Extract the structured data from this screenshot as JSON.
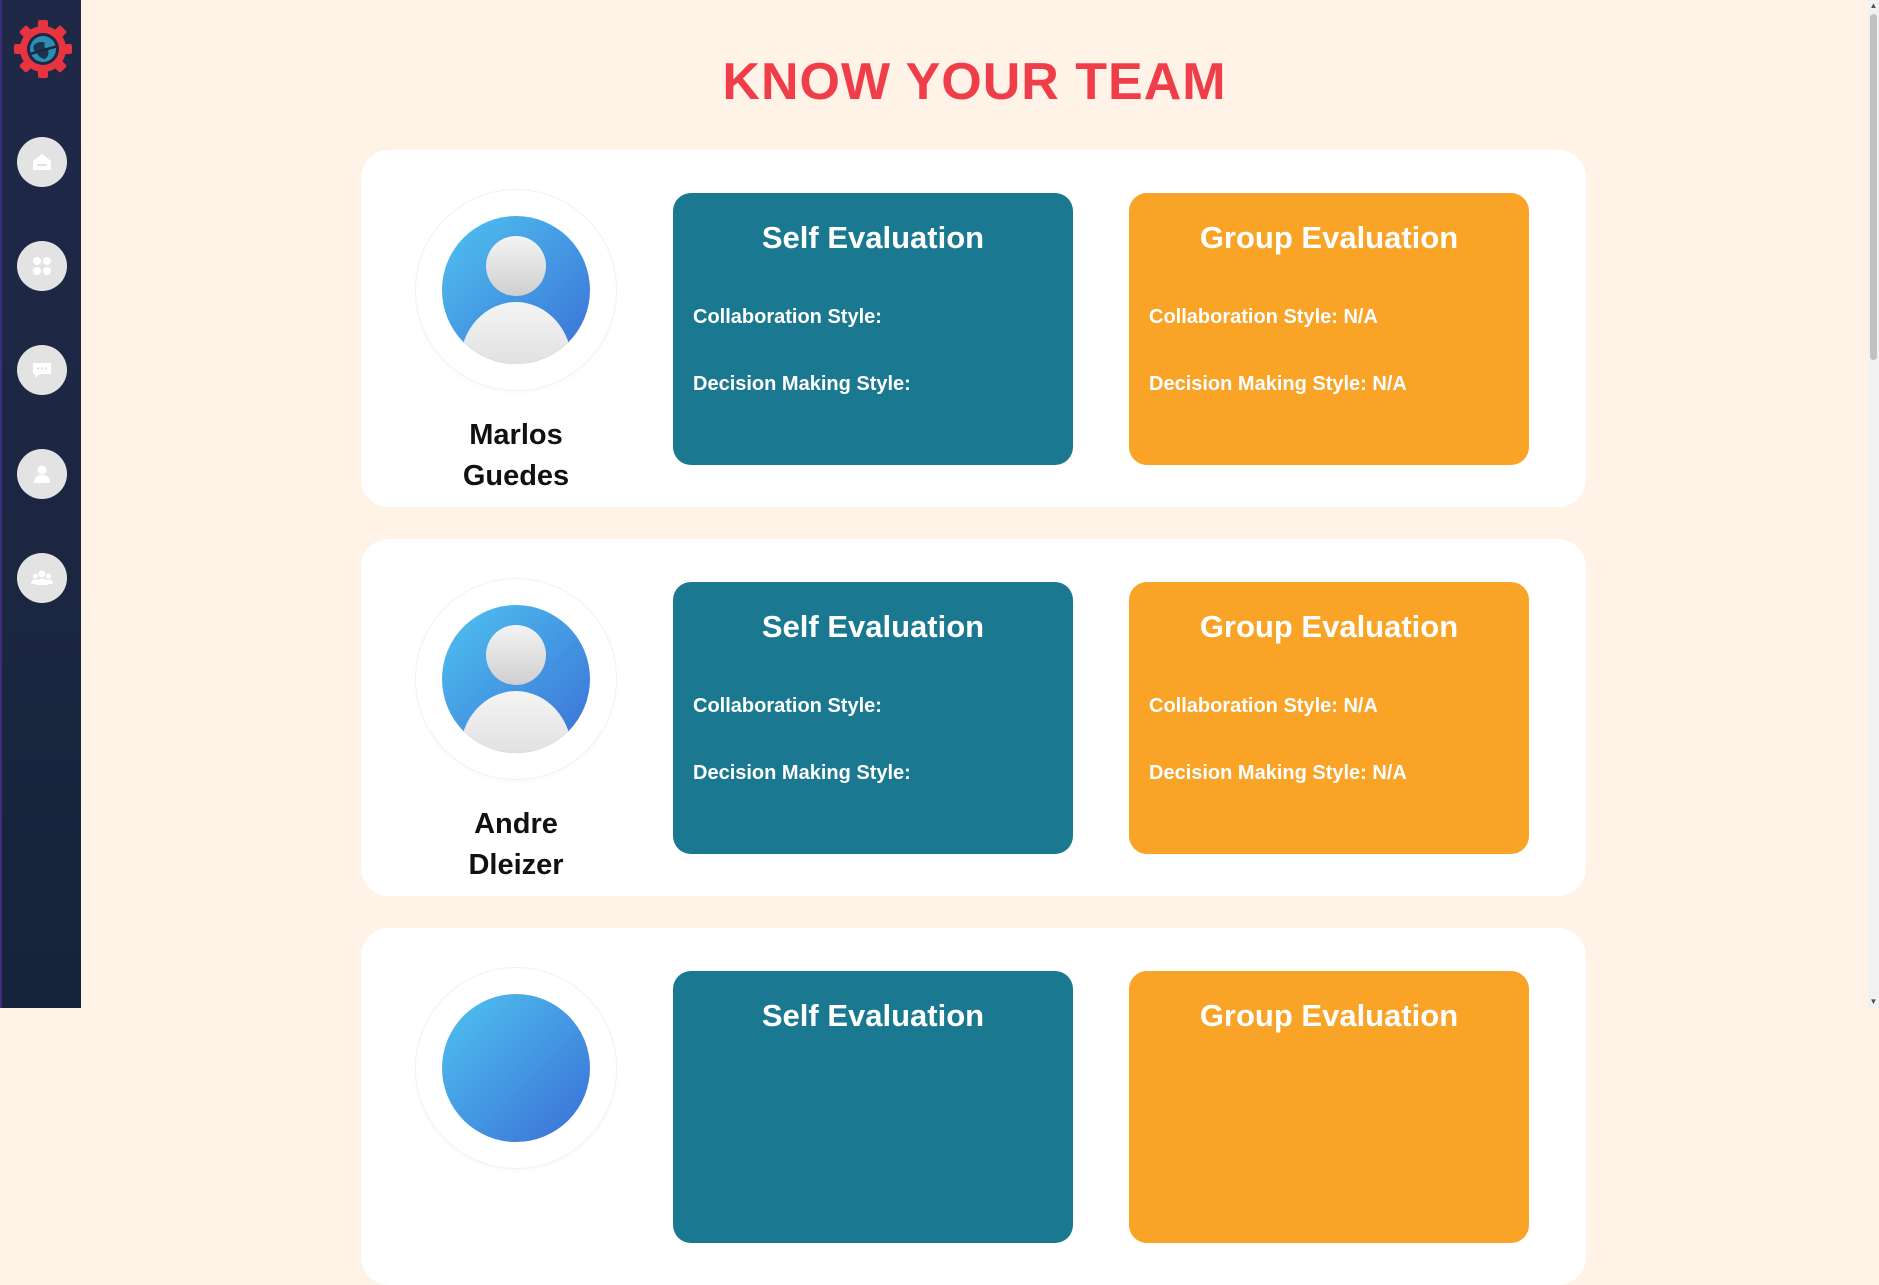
{
  "page": {
    "title": "KNOW YOUR TEAM"
  },
  "sidebar": {
    "logo_icon": "gear-globe-logo-icon",
    "items": [
      {
        "icon": "home-icon"
      },
      {
        "icon": "dashboard-grid-icon"
      },
      {
        "icon": "chat-bubble-icon"
      },
      {
        "icon": "user-icon"
      },
      {
        "icon": "team-group-icon"
      }
    ]
  },
  "members": [
    {
      "name_first": "Marlos",
      "name_last": "Guedes",
      "self": {
        "title": "Self Evaluation",
        "collaboration": "Collaboration Style:",
        "decision": "Decision Making Style:"
      },
      "group": {
        "title": "Group Evaluation",
        "collaboration": "Collaboration Style: N/A",
        "decision": "Decision Making Style: N/A"
      }
    },
    {
      "name_first": "Andre",
      "name_last": "Dleizer",
      "self": {
        "title": "Self Evaluation",
        "collaboration": "Collaboration Style:",
        "decision": "Decision Making Style:"
      },
      "group": {
        "title": "Group Evaluation",
        "collaboration": "Collaboration Style: N/A",
        "decision": "Decision Making Style: N/A"
      }
    },
    {
      "self": {
        "title": "Self Evaluation"
      },
      "group": {
        "title": "Group Evaluation"
      }
    }
  ],
  "colors": {
    "background": "#fff2e6",
    "title": "#ef3e4a",
    "self_eval": "#1a7990",
    "group_eval": "#f9a327",
    "sidebar": "#1c2641"
  }
}
